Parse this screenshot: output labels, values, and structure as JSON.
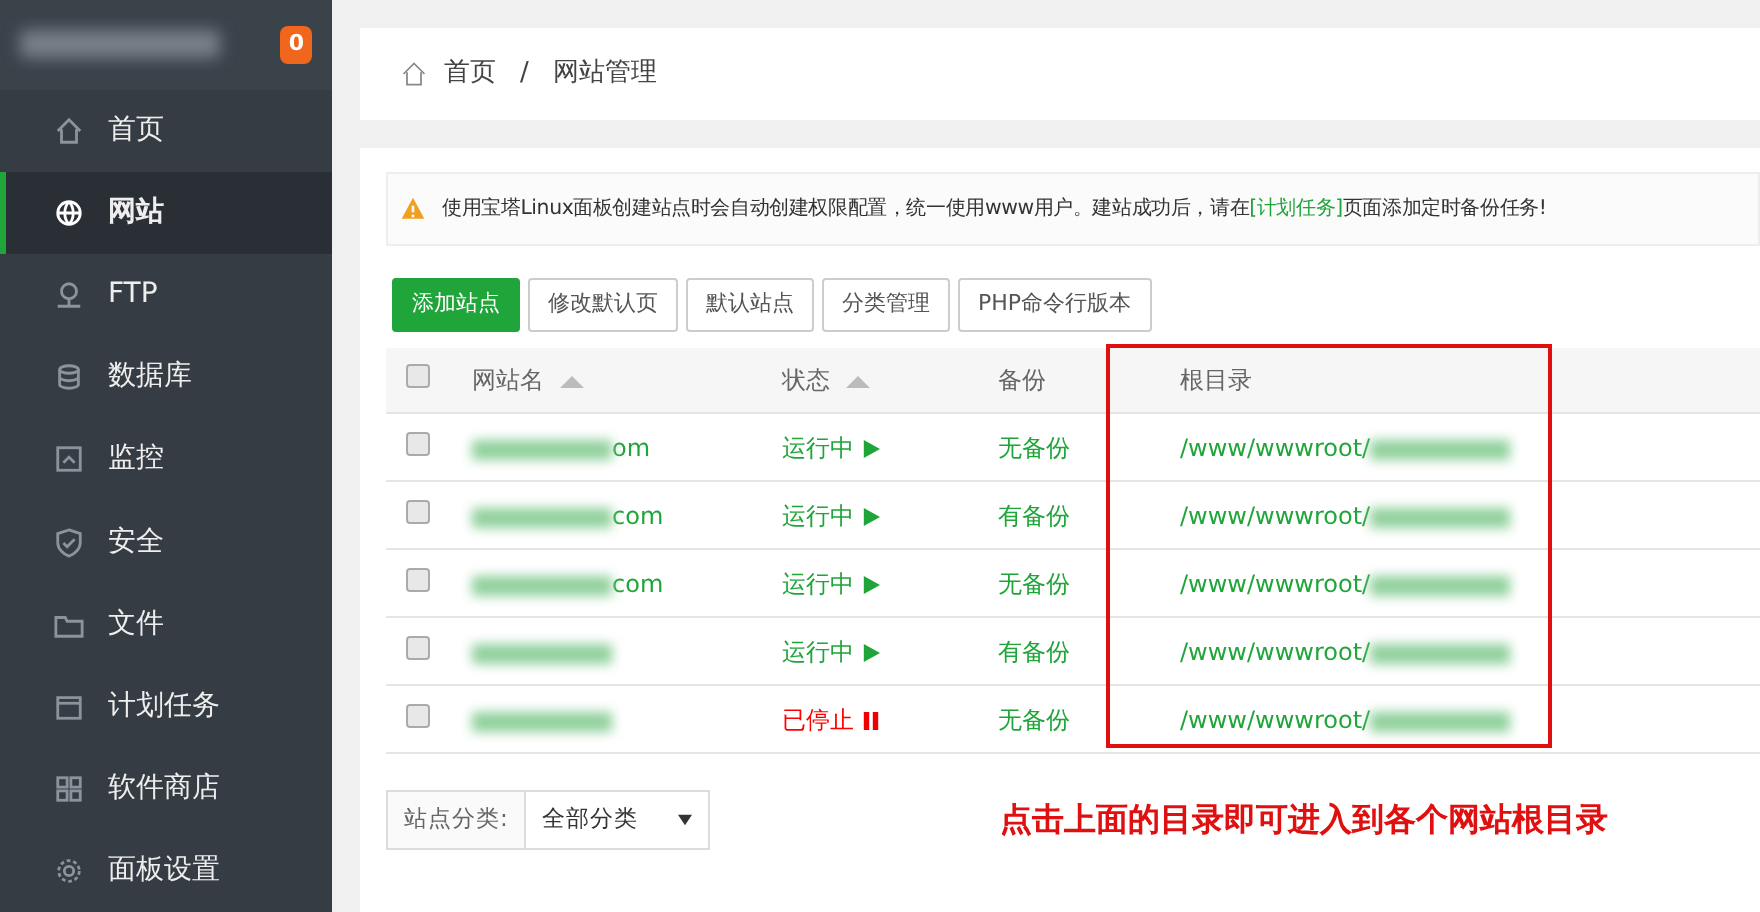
{
  "sidebar": {
    "badge": "0",
    "items": [
      {
        "label": "首页",
        "selected": false
      },
      {
        "label": "网站",
        "selected": true
      },
      {
        "label": "FTP",
        "selected": false
      },
      {
        "label": "数据库",
        "selected": false
      },
      {
        "label": "监控",
        "selected": false
      },
      {
        "label": "安全",
        "selected": false
      },
      {
        "label": "文件",
        "selected": false
      },
      {
        "label": "计划任务",
        "selected": false
      },
      {
        "label": "软件商店",
        "selected": false
      },
      {
        "label": "面板设置",
        "selected": false
      }
    ]
  },
  "breadcrumb": {
    "separator": "/",
    "items": [
      "首页",
      "网站管理"
    ]
  },
  "notice": {
    "text": "使用宝塔Linux面板创建站点时会自动创建权限配置，统一使用www用户。建站成功后，请在",
    "link": "[计划任务]",
    "after": "页面添加定时备份任务!"
  },
  "buttons": [
    {
      "label": "添加站点",
      "primary": true
    },
    {
      "label": "修改默认页",
      "primary": false
    },
    {
      "label": "默认站点",
      "primary": false
    },
    {
      "label": "分类管理",
      "primary": false
    },
    {
      "label": "PHP命令行版本",
      "primary": false
    }
  ],
  "table": {
    "select_all_checked": false,
    "columns": [
      {
        "label": "网站名",
        "sortable": true
      },
      {
        "label": "状态",
        "sortable": true
      },
      {
        "label": "备份",
        "sortable": false
      },
      {
        "label": "根目录",
        "sortable": false
      }
    ],
    "rows": [
      {
        "checked": false,
        "name": "om",
        "status": "运行中",
        "running": true,
        "backup": "无备份",
        "root": "/www/wwwroot/"
      },
      {
        "checked": false,
        "name": "com",
        "status": "运行中",
        "running": true,
        "backup": "有备份",
        "root": "/www/wwwroot/"
      },
      {
        "checked": false,
        "name": "com",
        "status": "运行中",
        "running": true,
        "backup": "无备份",
        "root": "/www/wwwroot/"
      },
      {
        "checked": false,
        "name": "",
        "status": "运行中",
        "running": true,
        "backup": "有备份",
        "root": "/www/wwwroot/"
      },
      {
        "checked": false,
        "name": "",
        "status": "已停止",
        "running": false,
        "backup": "无备份",
        "root": "/www/wwwroot/"
      }
    ]
  },
  "filter": {
    "label": "站点分类:",
    "value": "全部分类"
  },
  "annotation": "点击上面的目录即可进入到各个网站根目录"
}
